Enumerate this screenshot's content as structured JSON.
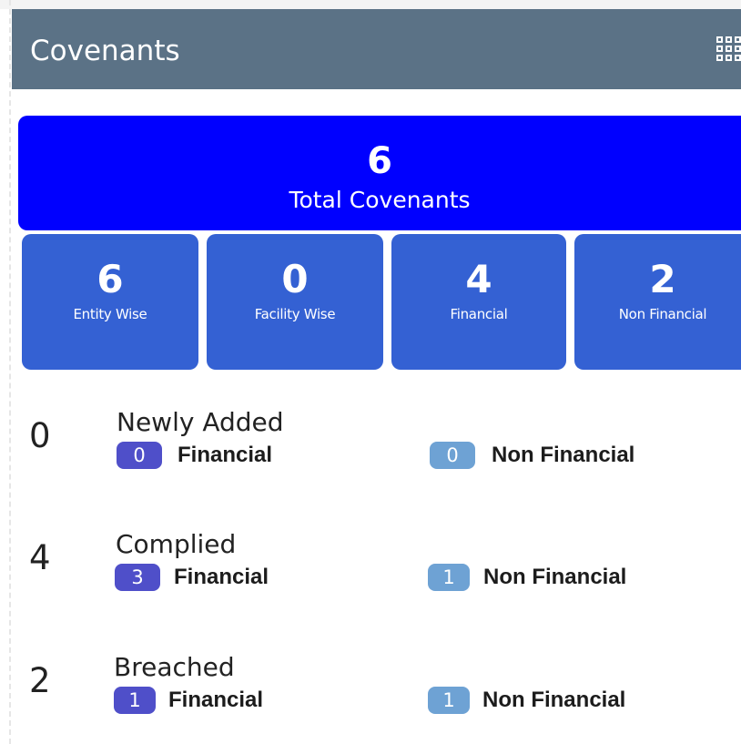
{
  "header": {
    "title": "Covenants",
    "menu_icon": "grid-icon"
  },
  "total": {
    "value": "6",
    "label": "Total Covenants"
  },
  "tiles": [
    {
      "value": "6",
      "label": "Entity Wise"
    },
    {
      "value": "0",
      "label": "Facility Wise"
    },
    {
      "value": "4",
      "label": "Financial"
    },
    {
      "value": "2",
      "label": "Non Financial"
    }
  ],
  "rows": [
    {
      "count": "0",
      "title": "Newly Added",
      "financial": "0",
      "financial_label": "Financial",
      "non_financial": "0",
      "non_financial_label": "Non Financial"
    },
    {
      "count": "4",
      "title": "Complied",
      "financial": "3",
      "financial_label": "Financial",
      "non_financial": "1",
      "non_financial_label": "Non Financial"
    },
    {
      "count": "2",
      "title": "Breached",
      "financial": "1",
      "financial_label": "Financial",
      "non_financial": "1",
      "non_financial_label": "Non Financial"
    }
  ],
  "colors": {
    "header_bg": "#5b7286",
    "total_bg": "#0000ff",
    "tile_bg": "#3461d3",
    "badge_financial": "#4f4fc9",
    "badge_non_financial": "#6ea2d4"
  }
}
